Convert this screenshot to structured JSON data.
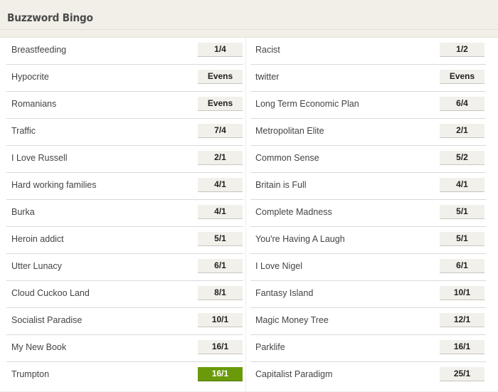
{
  "header": {
    "title": "Buzzword Bingo"
  },
  "colors": {
    "selected_odds_bg": "#6a9a0a",
    "odds_bg": "#f2f0ea"
  },
  "left": [
    {
      "label": "Breastfeeding",
      "odds": "1/4"
    },
    {
      "label": "Hypocrite",
      "odds": "Evens"
    },
    {
      "label": "Romanians",
      "odds": "Evens"
    },
    {
      "label": "Traffic",
      "odds": "7/4"
    },
    {
      "label": "I Love Russell",
      "odds": "2/1"
    },
    {
      "label": "Hard working families",
      "odds": "4/1"
    },
    {
      "label": "Burka",
      "odds": "4/1"
    },
    {
      "label": "Heroin addict",
      "odds": "5/1"
    },
    {
      "label": "Utter Lunacy",
      "odds": "6/1"
    },
    {
      "label": "Cloud Cuckoo Land",
      "odds": "8/1"
    },
    {
      "label": "Socialist Paradise",
      "odds": "10/1"
    },
    {
      "label": "My New Book",
      "odds": "16/1"
    },
    {
      "label": "Trumpton",
      "odds": "16/1",
      "selected": true
    }
  ],
  "right": [
    {
      "label": "Racist",
      "odds": "1/2"
    },
    {
      "label": "twitter",
      "odds": "Evens"
    },
    {
      "label": "Long Term Economic Plan",
      "odds": "6/4"
    },
    {
      "label": "Metropolitan Elite",
      "odds": "2/1"
    },
    {
      "label": "Common Sense",
      "odds": "5/2"
    },
    {
      "label": "Britain is Full",
      "odds": "4/1"
    },
    {
      "label": "Complete Madness",
      "odds": "5/1"
    },
    {
      "label": "You're Having A Laugh",
      "odds": "5/1"
    },
    {
      "label": "I Love Nigel",
      "odds": "6/1"
    },
    {
      "label": "Fantasy Island",
      "odds": "10/1"
    },
    {
      "label": "Magic Money Tree",
      "odds": "12/1"
    },
    {
      "label": "Parklife",
      "odds": "16/1"
    },
    {
      "label": "Capitalist Paradigm",
      "odds": "25/1"
    }
  ]
}
